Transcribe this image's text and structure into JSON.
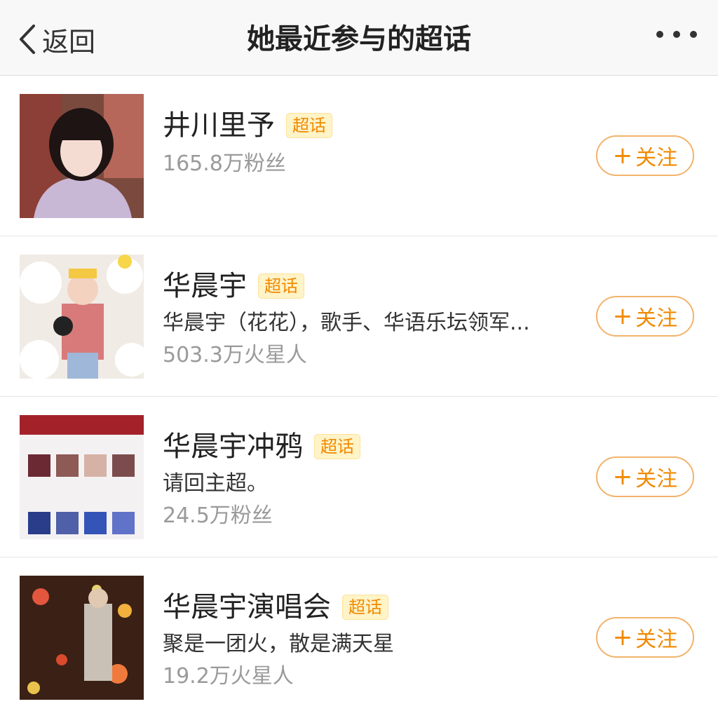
{
  "nav": {
    "back_label": "返回",
    "title": "她最近参与的超话"
  },
  "topics": [
    {
      "name": "井川里予",
      "badge": "超话",
      "description": "",
      "fans": "165.8万粉丝",
      "follow_label": "关注"
    },
    {
      "name": "华晨宇",
      "badge": "超话",
      "description": "华晨宇（花花），歌手、华语乐坛领军...",
      "fans": "503.3万火星人",
      "follow_label": "关注"
    },
    {
      "name": "华晨宇冲鸦",
      "badge": "超话",
      "description": "请回主超。",
      "fans": "24.5万粉丝",
      "follow_label": "关注"
    },
    {
      "name": "华晨宇演唱会",
      "badge": "超话",
      "description": "聚是一团火，散是满天星",
      "fans": "19.2万火星人",
      "follow_label": "关注"
    }
  ],
  "colors": {
    "accent": "#f08a00",
    "badge_bg": "#fff3c8",
    "follow_border": "#f2b36b"
  }
}
